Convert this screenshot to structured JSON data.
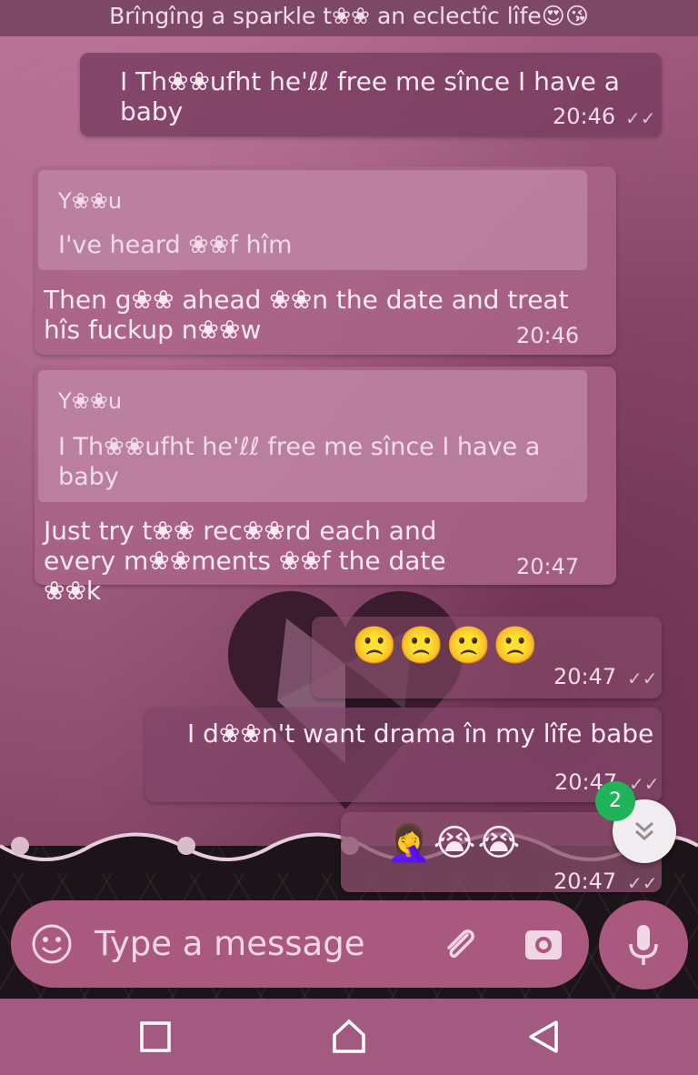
{
  "header": {
    "status_text": "Brîngîng a sparkle t❀❀ an eclectîc lîfe😍😘"
  },
  "messages": [
    {
      "id": "m1",
      "direction": "out",
      "text": "I Th❀❀ufht he'ℓℓ free me sînce I have a baby",
      "time": "20:46",
      "ticks": "✓✓"
    },
    {
      "id": "m2",
      "direction": "in",
      "quote_author": "Y❀❀u",
      "quote_text": "I've heard ❀❀f hîm",
      "text": "Then g❀❀ ahead ❀❀n the date and treat hîs fuckup n❀❀w",
      "time": "20:46"
    },
    {
      "id": "m3",
      "direction": "in",
      "quote_author": "Y❀❀u",
      "quote_text": "I Th❀❀ufht he'ℓℓ free me sînce I have a baby",
      "text": "Just try t❀❀ rec❀❀rd each and every m❀❀ments ❀❀f the date ❀❀k",
      "time": "20:47"
    },
    {
      "id": "m4",
      "direction": "out",
      "text": "🙁🙁🙁🙁",
      "time": "20:47",
      "ticks": "✓✓"
    },
    {
      "id": "m5",
      "direction": "out",
      "text": "I d❀❀n't want drama în my lîfe babe",
      "time": "20:47",
      "ticks": "✓✓"
    },
    {
      "id": "m6",
      "direction": "out",
      "text": "🤦‍♀️😭😭",
      "time": "20:47",
      "ticks": "✓✓"
    }
  ],
  "unread_badge": "2",
  "composer": {
    "placeholder": "Type a message"
  },
  "icons": {
    "emoji": "emoji-icon",
    "attach": "paperclip-icon",
    "camera": "camera-icon",
    "mic": "microphone-icon",
    "scroll": "chevron-double-down-icon",
    "nav_recent": "square-icon",
    "nav_home": "home-icon",
    "nav_back": "back-triangle-icon"
  },
  "colors": {
    "header_bg": "#7d4866",
    "composer_bg": "#a9587e",
    "badge": "#1fb35a",
    "navbar_bg": "#a35a80"
  }
}
